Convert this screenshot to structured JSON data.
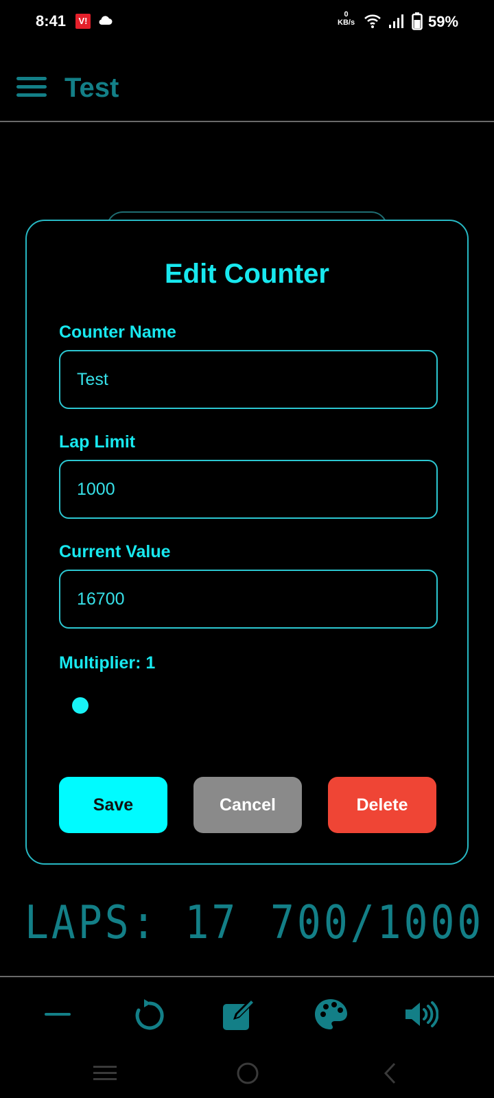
{
  "status_bar": {
    "time": "8:41",
    "carrier_badge": "Vi",
    "net_speed_value": "0",
    "net_speed_unit": "KB/s",
    "battery_percent": "59%"
  },
  "app_bar": {
    "title": "Test",
    "menu_icon": "hamburger-menu-icon"
  },
  "dialog": {
    "title": "Edit Counter",
    "counter_name": {
      "label": "Counter Name",
      "value": "Test"
    },
    "lap_limit": {
      "label": "Lap Limit",
      "value": "1000"
    },
    "current_value": {
      "label": "Current Value",
      "value": "16700"
    },
    "multiplier": {
      "label": "Multiplier: 1",
      "value": 1
    },
    "buttons": {
      "save": "Save",
      "cancel": "Cancel",
      "delete": "Delete"
    }
  },
  "display": {
    "laps": "LAPS: 17",
    "count": "700/1000"
  },
  "toolbar": [
    "minus-icon",
    "reset-icon",
    "edit-icon",
    "palette-icon",
    "volume-icon"
  ],
  "nav_bar": [
    "recents-icon",
    "home-icon",
    "back-icon"
  ],
  "colors": {
    "accent": "#18e8ef",
    "teal_dark": "#137f87",
    "save": "#00fbff",
    "cancel": "#8a8a8a",
    "delete": "#ef4535"
  }
}
